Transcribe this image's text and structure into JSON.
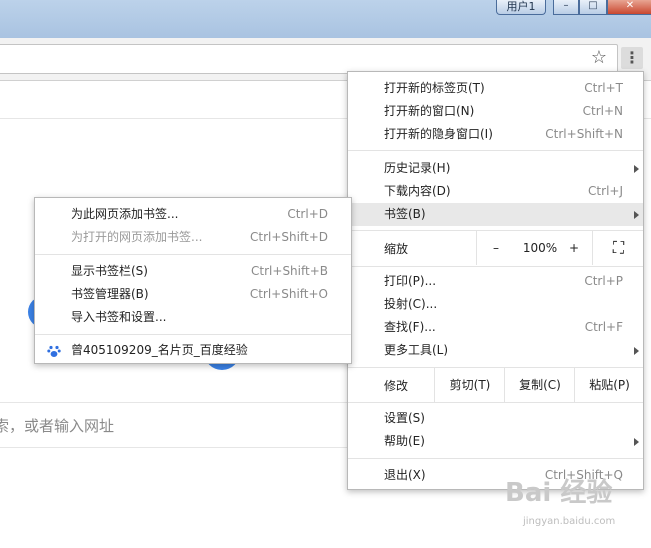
{
  "titlebar": {
    "user_label": "用户1",
    "minimize": "–",
    "maximize": "□",
    "close": "✕"
  },
  "toolbar": {
    "bookmark_star": "☆",
    "menu_icon": "⋮"
  },
  "page": {
    "search_hint": "索，或者输入网址"
  },
  "menu": {
    "new_tab": {
      "label": "打开新的标签页(T)",
      "shortcut": "Ctrl+T"
    },
    "new_window": {
      "label": "打开新的窗口(N)",
      "shortcut": "Ctrl+N"
    },
    "new_incognito": {
      "label": "打开新的隐身窗口(I)",
      "shortcut": "Ctrl+Shift+N"
    },
    "history": {
      "label": "历史记录(H)"
    },
    "downloads": {
      "label": "下载内容(D)",
      "shortcut": "Ctrl+J"
    },
    "bookmarks": {
      "label": "书签(B)"
    },
    "zoom": {
      "label": "缩放",
      "minus": "–",
      "value": "100%",
      "plus": "+",
      "fullscreen": "⛶"
    },
    "print": {
      "label": "打印(P)...",
      "shortcut": "Ctrl+P"
    },
    "cast": {
      "label": "投射(C)..."
    },
    "find": {
      "label": "查找(F)...",
      "shortcut": "Ctrl+F"
    },
    "more_tools": {
      "label": "更多工具(L)"
    },
    "edit": {
      "label": "修改",
      "cut": "剪切(T)",
      "copy": "复制(C)",
      "paste": "粘贴(P)"
    },
    "settings": {
      "label": "设置(S)"
    },
    "help": {
      "label": "帮助(E)"
    },
    "exit": {
      "label": "退出(X)",
      "shortcut": "Ctrl+Shift+Q"
    }
  },
  "submenu": {
    "bookmark_page": {
      "label": "为此网页添加书签...",
      "shortcut": "Ctrl+D"
    },
    "bookmark_open_pages": {
      "label": "为打开的网页添加书签...",
      "shortcut": "Ctrl+Shift+D"
    },
    "show_bar": {
      "label": "显示书签栏(S)",
      "shortcut": "Ctrl+Shift+B"
    },
    "manager": {
      "label": "书签管理器(B)",
      "shortcut": "Ctrl+Shift+O"
    },
    "import": {
      "label": "导入书签和设置..."
    },
    "bookmark_item": {
      "label": "曾405109209_名片页_百度经验"
    }
  },
  "watermark": {
    "brand": "Bai 经验",
    "url": "jingyan.baidu.com"
  }
}
